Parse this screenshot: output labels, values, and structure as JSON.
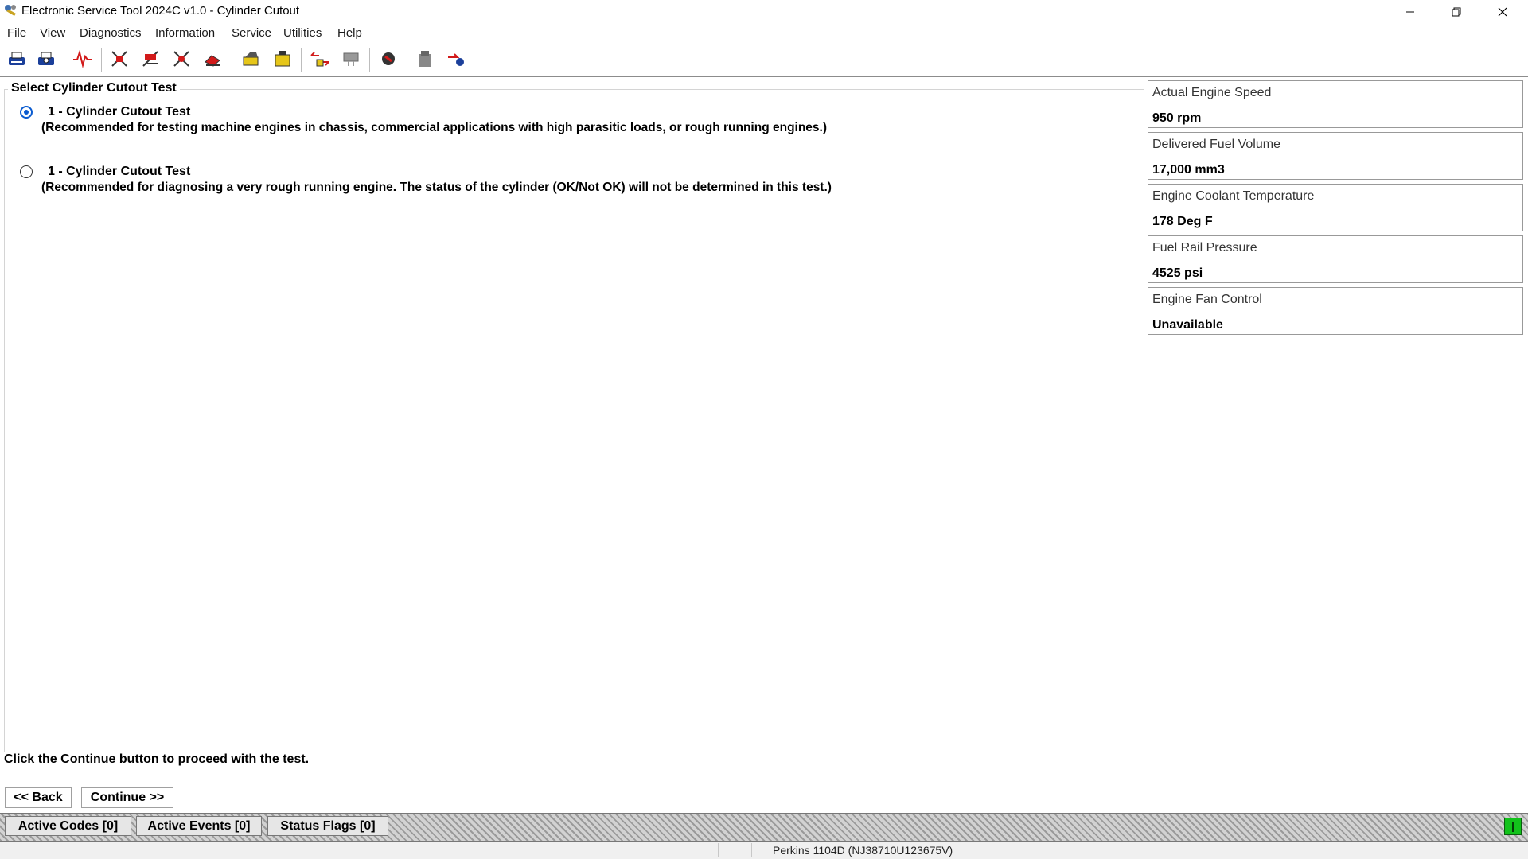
{
  "window": {
    "title": "Electronic Service Tool 2024C v1.0 - Cylinder Cutout",
    "controls": [
      "minimize-icon",
      "restore-icon",
      "close-icon"
    ]
  },
  "menu": [
    "File",
    "View",
    "Diagnostics",
    "Information",
    "Service",
    "Utilities",
    "Help"
  ],
  "toolbar": {
    "icons": [
      "print-icon",
      "print-preview-icon",
      "status-waveform-icon",
      "active-diagnostics-icon",
      "logged-diagnostics-icon",
      "event-codes-icon",
      "clear-codes-icon",
      "configuration-icon",
      "ecm-summary-icon",
      "data-link-icon",
      "connect-icon",
      "disconnect-icon",
      "flash-program-icon",
      "winflash-icon"
    ]
  },
  "main": {
    "group_title": "Select Cylinder Cutout Test",
    "options": [
      {
        "title": "1 - Cylinder Cutout Test",
        "description": "(Recommended for testing machine engines in chassis, commercial applications with high parasitic loads, or rough running engines.)",
        "selected": true
      },
      {
        "title": "1 - Cylinder Cutout Test",
        "description": "(Recommended for diagnosing a very rough running engine. The status of the cylinder (OK/Not OK) will not be determined in this test.)",
        "selected": false
      }
    ],
    "instruction": "Click the Continue button to proceed with the test.",
    "back_label": "<< Back",
    "continue_label": "Continue >>"
  },
  "parameters": [
    {
      "label": "Actual Engine Speed",
      "value": "950 rpm"
    },
    {
      "label": "Delivered Fuel Volume",
      "value": "17,000 mm3"
    },
    {
      "label": "Engine Coolant Temperature",
      "value": "178 Deg F"
    },
    {
      "label": "Fuel Rail Pressure",
      "value": "4525 psi"
    },
    {
      "label": "Engine Fan Control",
      "value": "Unavailable"
    }
  ],
  "status_bar": {
    "active_codes": "Active Codes [0]",
    "active_events": "Active Events [0]",
    "status_flags": "Status Flags [0]",
    "connection_color": "#12c21b"
  },
  "footer": {
    "ecm": "Perkins 1104D (NJ38710U123675V)"
  }
}
